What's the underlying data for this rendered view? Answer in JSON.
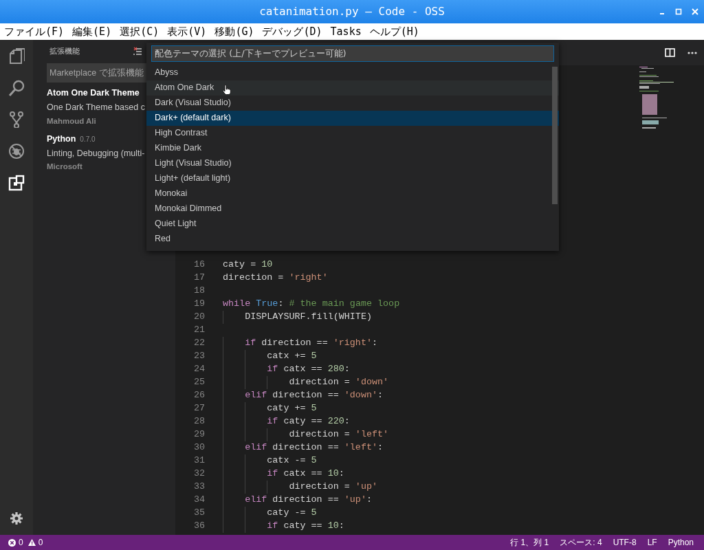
{
  "window": {
    "title": "catanimation.py — Code - OSS"
  },
  "menu": [
    "ファイル(F)",
    "編集(E)",
    "選択(C)",
    "表示(V)",
    "移動(G)",
    "デバッグ(D)",
    "Tasks",
    "ヘルプ(H)"
  ],
  "activity_bar": [
    {
      "kind": "files",
      "selected": false
    },
    {
      "kind": "search",
      "selected": false
    },
    {
      "kind": "git",
      "selected": false
    },
    {
      "kind": "debug",
      "selected": false
    },
    {
      "kind": "extensions",
      "selected": true
    }
  ],
  "sidebar": {
    "title": "拡張機能",
    "search": {
      "placeholder": "Marketplace で拡張機能"
    },
    "extensions": [
      {
        "name": "Atom One Dark Theme",
        "description": "One Dark Theme based c",
        "publisher": "Mahmoud Ali"
      },
      {
        "name": "Python",
        "version": "0.7.0",
        "description": "Linting, Debugging (multi-",
        "publisher": "Microsoft"
      }
    ]
  },
  "quick_pick": {
    "placeholder": "配色テーマの選択 (上/下キーでプレビュー可能)",
    "items": [
      {
        "label": "Abyss",
        "selected": false,
        "hovered": false
      },
      {
        "label": "Atom One Dark",
        "selected": false,
        "hovered": true
      },
      {
        "label": "Dark (Visual Studio)",
        "selected": false,
        "hovered": false
      },
      {
        "label": "Dark+ (default dark)",
        "selected": true,
        "hovered": false
      },
      {
        "label": "High Contrast",
        "selected": false,
        "hovered": false
      },
      {
        "label": "Kimbie Dark",
        "selected": false,
        "hovered": false
      },
      {
        "label": "Light (Visual Studio)",
        "selected": false,
        "hovered": false
      },
      {
        "label": "Light+ (default light)",
        "selected": false,
        "hovered": false
      },
      {
        "label": "Monokai",
        "selected": false,
        "hovered": false
      },
      {
        "label": "Monokai Dimmed",
        "selected": false,
        "hovered": false
      },
      {
        "label": "Quiet Light",
        "selected": false,
        "hovered": false
      },
      {
        "label": "Red",
        "selected": false,
        "hovered": false
      }
    ]
  },
  "editor": {
    "lines": [
      {
        "n": "16",
        "tokens": [
          {
            "kind": "plain",
            "text": "caty = "
          },
          {
            "kind": "num",
            "text": "10"
          }
        ]
      },
      {
        "n": "17",
        "tokens": [
          {
            "kind": "plain",
            "text": "direction = "
          },
          {
            "kind": "str",
            "text": "'right'"
          }
        ]
      },
      {
        "n": "18"
      },
      {
        "n": "19",
        "tokens": [
          {
            "kind": "kw",
            "text": "while"
          },
          {
            "kind": "const",
            "text": " True"
          },
          {
            "kind": "plain",
            "text": ":"
          },
          {
            "kind": "comment",
            "text": " # the main game loop"
          }
        ]
      },
      {
        "n": "20",
        "tokens": [
          {
            "kind": "plain",
            "text": "    DISPLAYSURF.fill(WHITE)"
          }
        ]
      },
      {
        "n": "21"
      },
      {
        "n": "22",
        "tokens": [
          {
            "kind": "kw",
            "text": "    if"
          },
          {
            "kind": "plain",
            "text": " direction == "
          },
          {
            "kind": "str",
            "text": "'right'"
          },
          {
            "kind": "plain",
            "text": ":"
          }
        ]
      },
      {
        "n": "23",
        "tokens": [
          {
            "kind": "plain",
            "text": "        catx += "
          },
          {
            "kind": "num",
            "text": "5"
          }
        ]
      },
      {
        "n": "24",
        "tokens": [
          {
            "kind": "kw",
            "text": "        if"
          },
          {
            "kind": "plain",
            "text": " catx == "
          },
          {
            "kind": "num",
            "text": "280"
          },
          {
            "kind": "plain",
            "text": ":"
          }
        ]
      },
      {
        "n": "25",
        "tokens": [
          {
            "kind": "plain",
            "text": "            direction = "
          },
          {
            "kind": "str",
            "text": "'down'"
          }
        ]
      },
      {
        "n": "26",
        "tokens": [
          {
            "kind": "kw",
            "text": "    elif"
          },
          {
            "kind": "plain",
            "text": " direction == "
          },
          {
            "kind": "str",
            "text": "'down'"
          },
          {
            "kind": "plain",
            "text": ":"
          }
        ]
      },
      {
        "n": "27",
        "tokens": [
          {
            "kind": "plain",
            "text": "        caty += "
          },
          {
            "kind": "num",
            "text": "5"
          }
        ]
      },
      {
        "n": "28",
        "tokens": [
          {
            "kind": "kw",
            "text": "        if"
          },
          {
            "kind": "plain",
            "text": " caty == "
          },
          {
            "kind": "num",
            "text": "220"
          },
          {
            "kind": "plain",
            "text": ":"
          }
        ]
      },
      {
        "n": "29",
        "tokens": [
          {
            "kind": "plain",
            "text": "            direction = "
          },
          {
            "kind": "str",
            "text": "'left'"
          }
        ]
      },
      {
        "n": "30",
        "tokens": [
          {
            "kind": "kw",
            "text": "    elif"
          },
          {
            "kind": "plain",
            "text": " direction == "
          },
          {
            "kind": "str",
            "text": "'left'"
          },
          {
            "kind": "plain",
            "text": ":"
          }
        ]
      },
      {
        "n": "31",
        "tokens": [
          {
            "kind": "plain",
            "text": "        catx -= "
          },
          {
            "kind": "num",
            "text": "5"
          }
        ]
      },
      {
        "n": "32",
        "tokens": [
          {
            "kind": "kw",
            "text": "        if"
          },
          {
            "kind": "plain",
            "text": " catx == "
          },
          {
            "kind": "num",
            "text": "10"
          },
          {
            "kind": "plain",
            "text": ":"
          }
        ]
      },
      {
        "n": "33",
        "tokens": [
          {
            "kind": "plain",
            "text": "            direction = "
          },
          {
            "kind": "str",
            "text": "'up'"
          }
        ]
      },
      {
        "n": "34",
        "tokens": [
          {
            "kind": "kw",
            "text": "    elif"
          },
          {
            "kind": "plain",
            "text": " direction == "
          },
          {
            "kind": "str",
            "text": "'up'"
          },
          {
            "kind": "plain",
            "text": ":"
          }
        ]
      },
      {
        "n": "35",
        "tokens": [
          {
            "kind": "plain",
            "text": "        caty -= "
          },
          {
            "kind": "num",
            "text": "5"
          }
        ]
      },
      {
        "n": "36",
        "tokens": [
          {
            "kind": "kw",
            "text": "        if"
          },
          {
            "kind": "plain",
            "text": " caty == "
          },
          {
            "kind": "num",
            "text": "10"
          },
          {
            "kind": "plain",
            "text": ":"
          }
        ]
      }
    ]
  },
  "status_bar": {
    "errors": "0",
    "warnings": "0",
    "items": [
      "行 1、列 1",
      "スペース: 4",
      "UTF-8",
      "LF",
      "Python"
    ]
  }
}
